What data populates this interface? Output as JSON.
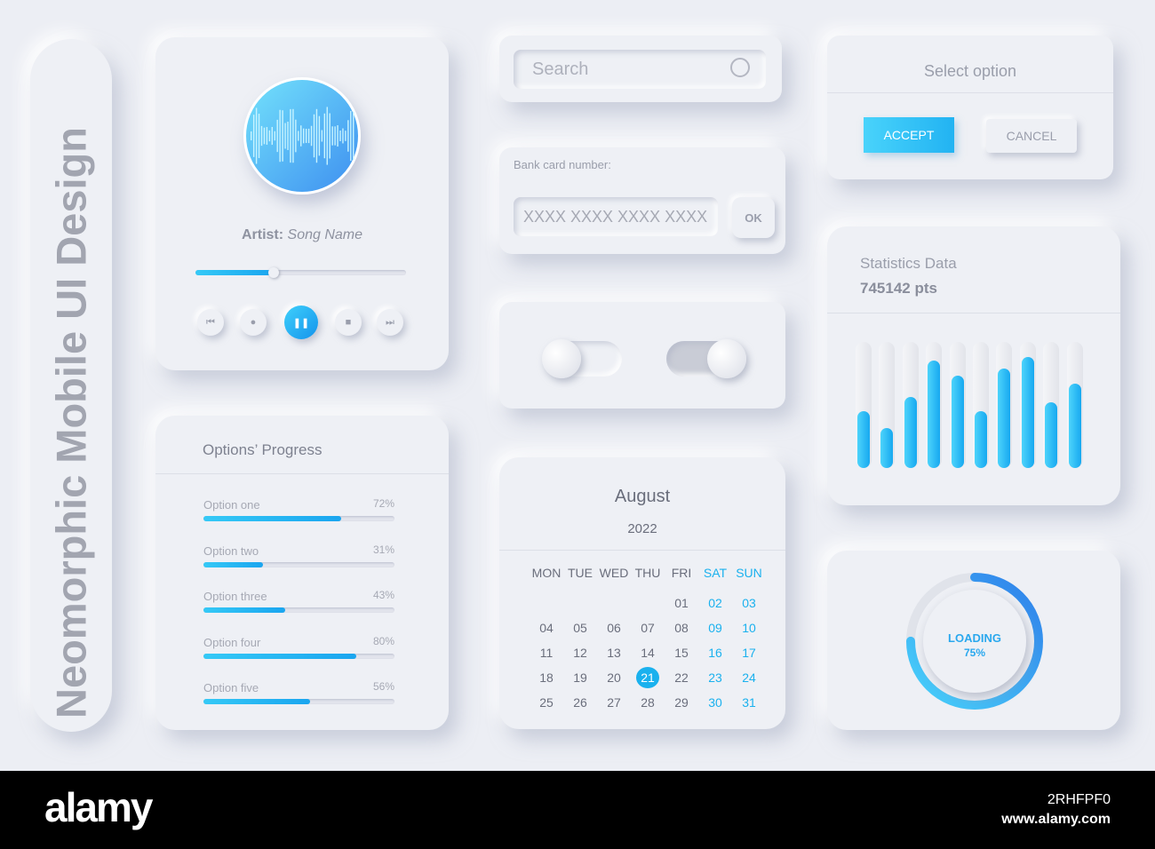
{
  "title": "Neomorphic Mobile UI Design",
  "player": {
    "artist": "Artist:",
    "song": "Song Name",
    "progress_percent": 37,
    "controls": [
      "previous-icon",
      "record-icon",
      "pause-icon",
      "stop-icon",
      "next-icon"
    ]
  },
  "progress": {
    "title": "Options’ Progress",
    "items": [
      {
        "label": "Option one",
        "value": "72%",
        "pct": 72
      },
      {
        "label": "Option two",
        "value": "31%",
        "pct": 31
      },
      {
        "label": "Option three",
        "value": "43%",
        "pct": 43
      },
      {
        "label": "Option four",
        "value": "80%",
        "pct": 80
      },
      {
        "label": "Option five",
        "value": "56%",
        "pct": 56
      }
    ]
  },
  "search": {
    "placeholder": "Search"
  },
  "card": {
    "label": "Bank card number:",
    "placeholder": "XXXX XXXX XXXX XXXX",
    "ok": "OK"
  },
  "toggles": [
    {
      "on": false
    },
    {
      "on": true
    }
  ],
  "calendar": {
    "month": "August",
    "year": "2022",
    "weekdays": [
      "MON",
      "TUE",
      "WED",
      "THU",
      "FRI",
      "SAT",
      "SUN"
    ],
    "first_col": 4,
    "days": 31,
    "selected": 21
  },
  "dialog": {
    "title": "Select option",
    "accept": "ACCEPT",
    "cancel": "CANCEL"
  },
  "stats": {
    "title": "Statistics Data",
    "value": "745142 pts",
    "bars": [
      45,
      32,
      56,
      85,
      73,
      45,
      79,
      88,
      52,
      67
    ]
  },
  "loading": {
    "label": "LOADING",
    "value": "75%",
    "pct": 75
  },
  "colors": {
    "accent": "#1ab1ee",
    "background": "#eceef4"
  },
  "footer": {
    "brand": "alamy",
    "id": "2RHFPF0",
    "url": "www.alamy.com"
  }
}
